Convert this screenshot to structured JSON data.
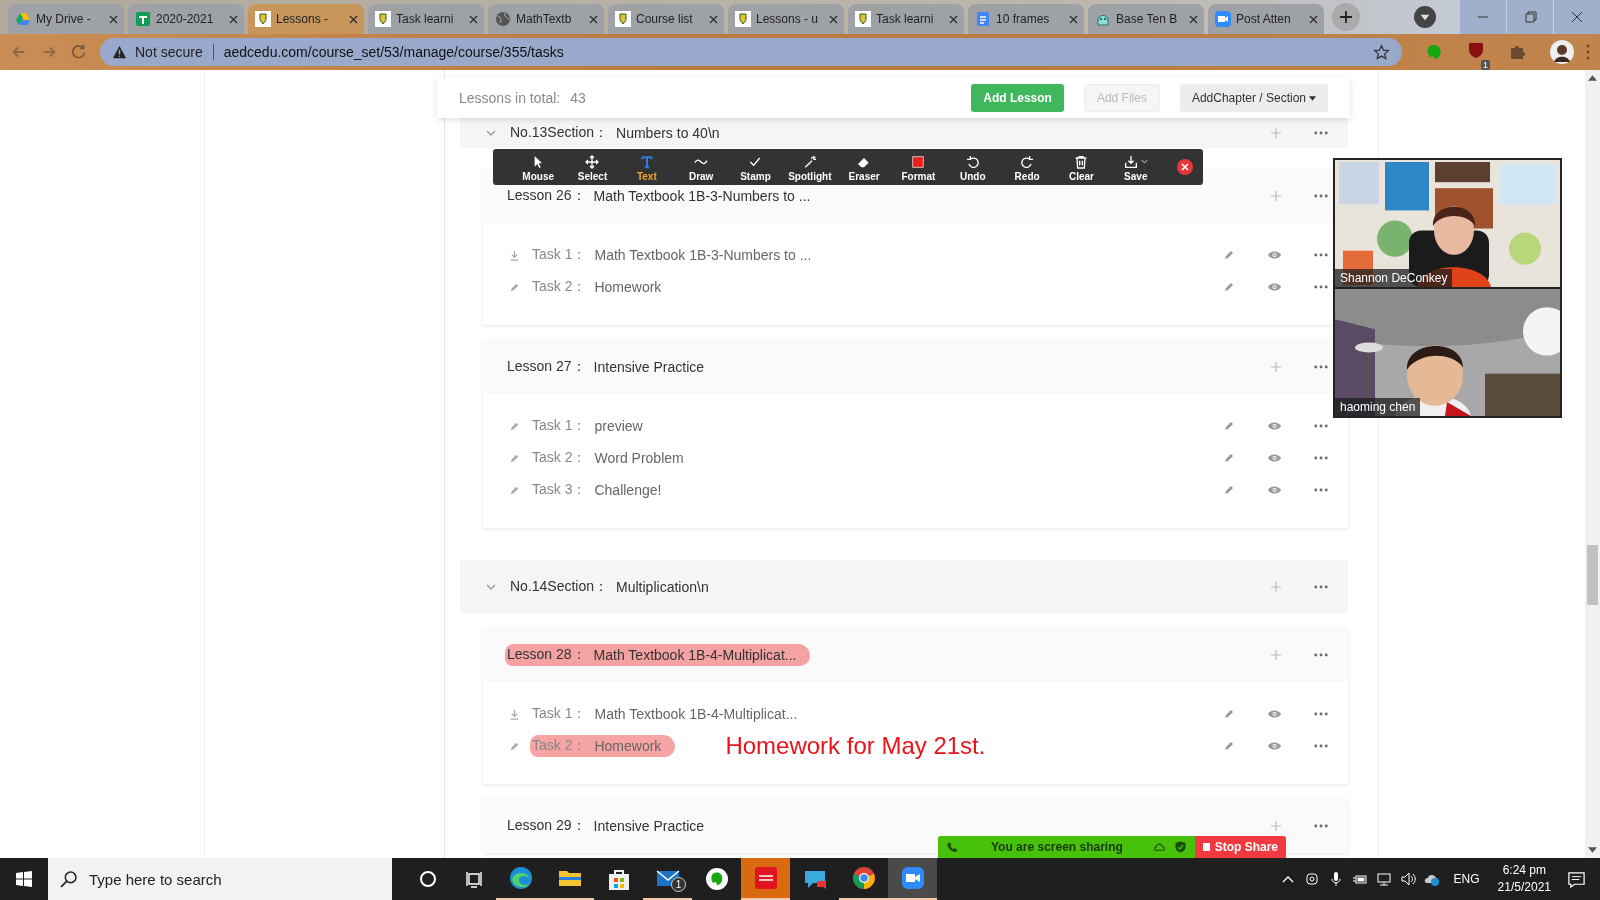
{
  "browser": {
    "tabs": [
      {
        "title": "My Drive -",
        "selected": false
      },
      {
        "title": "2020-2021",
        "selected": false
      },
      {
        "title": "Lessons -",
        "selected": true
      },
      {
        "title": "Task learni",
        "selected": false
      },
      {
        "title": "MathTextb",
        "selected": false
      },
      {
        "title": "Course list",
        "selected": false
      },
      {
        "title": "Lessons - u",
        "selected": false
      },
      {
        "title": "Task learni",
        "selected": false
      },
      {
        "title": "10 frames",
        "selected": false
      },
      {
        "title": "Base Ten B",
        "selected": false
      },
      {
        "title": "Post Atten",
        "selected": false
      }
    ],
    "security": "Not secure",
    "url": "aedcedu.com/course_set/53/manage/course/355/tasks",
    "extension_badge": "1"
  },
  "course": {
    "total_label": "Lessons in total:",
    "total": "43",
    "buttons": [
      {
        "label": "Add Lesson",
        "kind": "primary"
      },
      {
        "label": "Add Files",
        "kind": "disabled"
      },
      {
        "label": "AddChapter / Section",
        "kind": "dropdown"
      }
    ],
    "items": [
      {
        "kind": "section",
        "label": "No.13Section：",
        "title": "Numbers to 40\\n",
        "expanded": true
      },
      {
        "kind": "lesson",
        "label": "Lesson 26：",
        "title": "Math Textbook 1B-3-Numbers to ...",
        "highlighted": false,
        "tasks": [
          {
            "kind": "download",
            "label": "Task 1：",
            "title": "Math Textbook 1B-3-Numbers to ...",
            "highlighted": false
          },
          {
            "kind": "edit",
            "label": "Task 2：",
            "title": "Homework",
            "highlighted": false
          }
        ]
      },
      {
        "kind": "lesson",
        "label": "Lesson 27：",
        "title": "Intensive Practice",
        "highlighted": false,
        "tasks": [
          {
            "kind": "edit",
            "label": "Task 1：",
            "title": "preview",
            "highlighted": false
          },
          {
            "kind": "edit",
            "label": "Task 2：",
            "title": "Word Problem",
            "highlighted": false
          },
          {
            "kind": "edit",
            "label": "Task 3：",
            "title": "Challenge!",
            "highlighted": false
          }
        ]
      },
      {
        "kind": "section",
        "label": "No.14Section：",
        "title": "Multiplication\\n",
        "expanded": true
      },
      {
        "kind": "lesson",
        "label": "Lesson 28：",
        "title": "Math Textbook 1B-4-Multiplicat...",
        "highlighted": true,
        "tasks": [
          {
            "kind": "download",
            "label": "Task 1：",
            "title": "Math Textbook 1B-4-Multiplicat...",
            "highlighted": false
          },
          {
            "kind": "edit",
            "label": "Task 2：",
            "title": "Homework",
            "highlighted": true,
            "note": "Homework for May 21st."
          }
        ]
      },
      {
        "kind": "lesson",
        "label": "Lesson 29：",
        "title": "Intensive Practice",
        "highlighted": false
      }
    ]
  },
  "annotate_toolbar": {
    "tools": [
      {
        "label": "Mouse",
        "selected": false
      },
      {
        "label": "Select",
        "selected": false
      },
      {
        "label": "Text",
        "selected": true
      },
      {
        "label": "Draw",
        "selected": false
      },
      {
        "label": "Stamp",
        "selected": false
      },
      {
        "label": "Spotlight",
        "selected": false
      },
      {
        "label": "Eraser",
        "selected": false
      },
      {
        "label": "Format",
        "selected": false
      },
      {
        "label": "Undo",
        "selected": false
      },
      {
        "label": "Redo",
        "selected": false
      },
      {
        "label": "Clear",
        "selected": false
      },
      {
        "label": "Save",
        "selected": false
      }
    ]
  },
  "video": {
    "participants": [
      {
        "name": "Shannon DeConkey"
      },
      {
        "name": "haoming chen"
      }
    ]
  },
  "share_bar": {
    "status": "You are screen sharing",
    "button": "Stop Share"
  },
  "taskbar": {
    "search_placeholder": "Type here to search",
    "mail_badge": "1",
    "apps": [
      {
        "running": true,
        "selected": false,
        "attention": false
      },
      {
        "running": true,
        "selected": false,
        "attention": false
      },
      {
        "running": false,
        "selected": false,
        "attention": false
      },
      {
        "running": true,
        "selected": false,
        "attention": false
      },
      {
        "running": false,
        "selected": false,
        "attention": false
      },
      {
        "running": true,
        "selected": false,
        "attention": true
      },
      {
        "running": false,
        "selected": false,
        "attention": false
      },
      {
        "running": true,
        "selected": false,
        "attention": false
      },
      {
        "running": true,
        "selected": true,
        "attention": false
      }
    ],
    "language": "ENG",
    "time": "6:24 pm",
    "date": "21/5/2021"
  }
}
